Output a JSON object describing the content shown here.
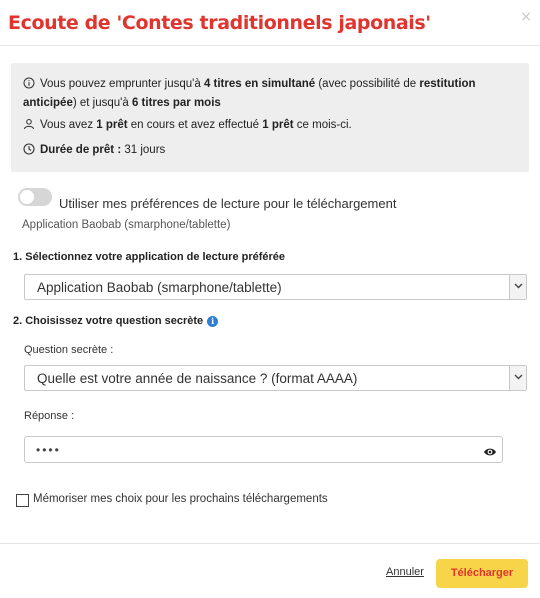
{
  "dialog": {
    "title": "Ecoute de 'Contes traditionnels japonais'",
    "close_glyph": "×"
  },
  "info": {
    "line1": {
      "t1": "Vous pouvez emprunter jusqu'à ",
      "b1": "4 titres en simultané",
      "t2": " (avec possibilité de ",
      "b2": "restitution anticipée",
      "t3": ") et jusqu'à ",
      "b3": "6 titres par mois"
    },
    "line2": {
      "t1": "Vous avez ",
      "b1": "1 prêt",
      "t2": " en cours et avez effectué ",
      "b2": "1 prêt",
      "t3": " ce mois-ci."
    },
    "line3": {
      "b1": "Durée de prêt :",
      "t1": " 31 jours"
    }
  },
  "preferences": {
    "toggle_label": "Utiliser mes préférences de lecture pour le téléchargement",
    "toggle_on": false,
    "app_subtitle": "Application Baobab (smarphone/tablette)"
  },
  "step1": {
    "heading": "1. Sélectionnez votre application de lecture préférée",
    "selected": "Application Baobab (smarphone/tablette)"
  },
  "step2": {
    "heading": "2. Choisissez votre question secrète",
    "question_label": "Question secrète :",
    "question_selected": "Quelle est votre année de naissance ? (format AAAA)",
    "answer_label": "Réponse :",
    "answer_value": "••••"
  },
  "remember": {
    "label": "Mémoriser mes choix pour les prochains téléchargements",
    "checked": false
  },
  "actions": {
    "cancel_label": "Annuler",
    "download_label": "Télécharger"
  },
  "colors": {
    "title": "#e0342f",
    "button_bg": "#f8d449",
    "button_text": "#e0342f",
    "info_bg": "#eeeeee",
    "info_dot": "#2e7fd1"
  },
  "icons": {
    "info_line1": "info-circle-icon",
    "info_line2": "user-icon",
    "info_line3": "clock-icon",
    "step2_help": "info-icon",
    "password_toggle": "eye-icon",
    "close": "close-icon",
    "select_arrow": "chevron-down-icon"
  }
}
